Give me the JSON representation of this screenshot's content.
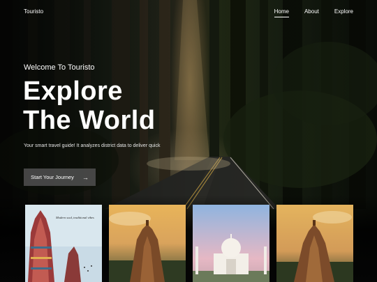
{
  "brand": {
    "name": "Touristo"
  },
  "nav": {
    "items": [
      {
        "label": "Home"
      },
      {
        "label": "About"
      },
      {
        "label": "Explore"
      }
    ],
    "active": "Home"
  },
  "hero": {
    "eyebrow": "Welcome To Touristo",
    "title_line1": "Explore",
    "title_line2": "The World",
    "description": "Your smart travel guide! It analyzes district data to deliver quick",
    "cta_label": "Start Your Journey",
    "cta_icon": "arrow-right-icon"
  },
  "cards": [
    {
      "name": "temple-gopuram-card",
      "caption": "Modern soul, traditional vibes"
    },
    {
      "name": "temple-tower-sunset-card"
    },
    {
      "name": "taj-mahal-card"
    },
    {
      "name": "temple-tower-card"
    }
  ]
}
